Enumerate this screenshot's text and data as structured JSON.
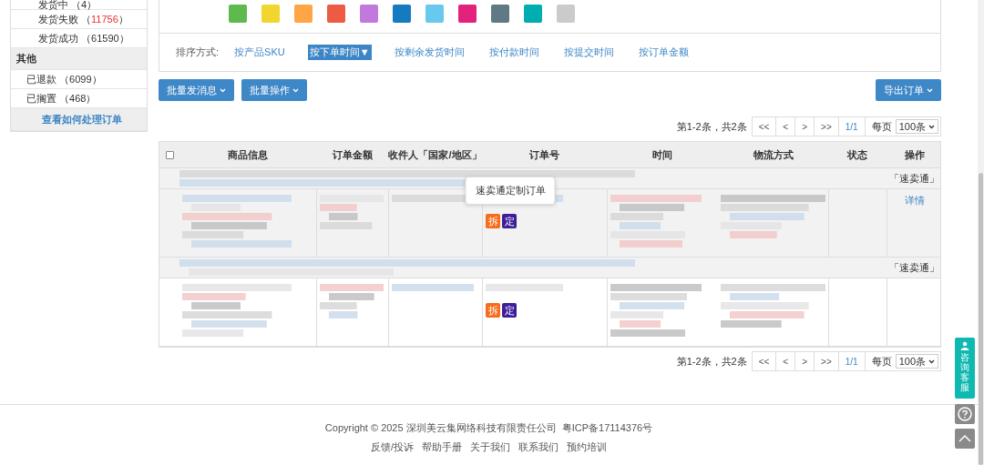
{
  "sidebar": {
    "items": [
      {
        "label": "发货中",
        "count": "（4）",
        "kind": "sub"
      },
      {
        "label": "发货失败",
        "prefix": "（",
        "count": "11756",
        "suffix": "）",
        "kind": "alert"
      },
      {
        "label": "发货成功",
        "count": "（61590）",
        "kind": "sub"
      },
      {
        "label": "其他",
        "kind": "header"
      },
      {
        "label": "已退款",
        "count": "（6099）",
        "kind": "item"
      },
      {
        "label": "已搁置",
        "count": "（468）",
        "kind": "item"
      },
      {
        "label": "查看如何处理订单",
        "kind": "link"
      }
    ]
  },
  "swatches": [
    {
      "color": "#5fba4d"
    },
    {
      "color": "#f0d62e"
    },
    {
      "color": "#fea646"
    },
    {
      "color": "#ee5b45"
    },
    {
      "color": "#c279de"
    },
    {
      "color": "#157ac0"
    },
    {
      "color": "#68c8ee"
    },
    {
      "color": "#e3227d"
    },
    {
      "color": "#5f7985"
    },
    {
      "color": "#00adb0"
    },
    {
      "color": "#cbcbcb"
    }
  ],
  "sort": {
    "label": "排序方式:",
    "options": [
      {
        "label": "按产品SKU",
        "selected": false
      },
      {
        "label": "按下单时间▼",
        "selected": true
      },
      {
        "label": "按剩余发货时间",
        "selected": false
      },
      {
        "label": "按付款时间",
        "selected": false
      },
      {
        "label": "按提交时间",
        "selected": false
      },
      {
        "label": "按订单金额",
        "selected": false
      }
    ]
  },
  "toolbar": {
    "left": [
      "批量发消息",
      "批量操作"
    ],
    "right": [
      "导出订单"
    ]
  },
  "pagination": [
    {
      "summary": "第1-2条，共2条",
      "first": "<<",
      "prev": "<",
      "next": ">",
      "last": ">>",
      "page": "1/1",
      "per_page_label": "每页",
      "per_page": "100条"
    },
    {
      "summary": "第1-2条，共2条",
      "first": "<<",
      "prev": "<",
      "next": ">",
      "last": ">>",
      "page": "1/1",
      "per_page_label": "每页",
      "per_page": "100条"
    }
  ],
  "table": {
    "select_all": {
      "checked": false
    },
    "columns": [
      "商品信息",
      "订单金额",
      "收件人「国家/地区」",
      "订单号",
      "时间",
      "物流方式",
      "状态",
      "操作"
    ],
    "orders": [
      {
        "platform": "「速卖通」",
        "tags": [
          {
            "label": "拆",
            "color": "#f76c1d"
          },
          {
            "label": "定",
            "color": "#3e1f9a"
          }
        ],
        "tooltip": "速卖通定制订单",
        "action": "详情",
        "shaded": true
      },
      {
        "platform": "「速卖通」",
        "tags": [
          {
            "label": "拆",
            "color": "#f76c1d"
          },
          {
            "label": "定",
            "color": "#3e1f9a"
          }
        ],
        "shaded": false
      }
    ]
  },
  "footer": {
    "copyright": "Copyright © 2025 深圳美云集网络科技有限责任公司",
    "icp": "粤ICP备17114376号",
    "links": [
      "反馈/投诉",
      "帮助手册",
      "关于我们",
      "联系我们",
      "预约培训"
    ]
  },
  "float": {
    "service": "咨询客服"
  }
}
